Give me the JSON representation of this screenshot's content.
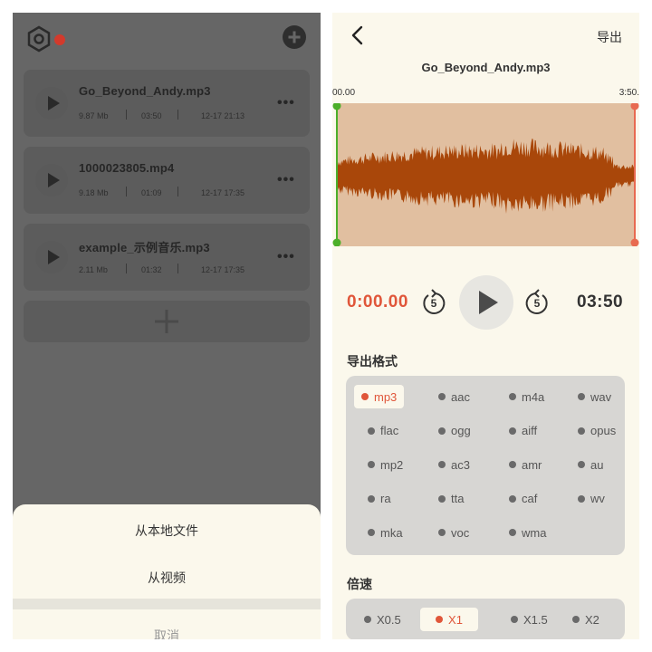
{
  "left": {
    "files": [
      {
        "name": "Go_Beyond_Andy.mp3",
        "size": "9.87 Mb",
        "duration": "03:50",
        "date": "12-17 21:13"
      },
      {
        "name": "1000023805.mp4",
        "size": "9.18 Mb",
        "duration": "01:09",
        "date": "12-17 17:35"
      },
      {
        "name": "example_示例音乐.mp3",
        "size": "2.11 Mb",
        "duration": "01:32",
        "date": "12-17 17:35"
      }
    ],
    "more_label": "•••",
    "sheet": {
      "local_file": "从本地文件",
      "from_video": "从视频",
      "cancel": "取消"
    }
  },
  "right": {
    "export_label": "导出",
    "title": "Go_Beyond_Andy.mp3",
    "time_start": "00.00",
    "time_end": "3:50.",
    "current_time": "0:00.00",
    "total_time": "03:50",
    "skip_seconds": "5",
    "format_label": "导出格式",
    "formats": [
      {
        "label": "mp3",
        "selected": true
      },
      {
        "label": "aac"
      },
      {
        "label": "m4a"
      },
      {
        "label": "wav"
      },
      {
        "label": "flac"
      },
      {
        "label": "ogg"
      },
      {
        "label": "aiff"
      },
      {
        "label": "opus"
      },
      {
        "label": "mp2"
      },
      {
        "label": "ac3"
      },
      {
        "label": "amr"
      },
      {
        "label": "au"
      },
      {
        "label": "ra"
      },
      {
        "label": "tta"
      },
      {
        "label": "caf"
      },
      {
        "label": "wv"
      },
      {
        "label": "mka"
      },
      {
        "label": "voc"
      },
      {
        "label": "wma"
      }
    ],
    "speed_label": "倍速",
    "speeds": [
      {
        "label": "X0.5"
      },
      {
        "label": "X1",
        "selected": true
      },
      {
        "label": "X1.5"
      },
      {
        "label": "X2"
      }
    ]
  },
  "colors": {
    "accent": "#e0563a",
    "waveform": "#a9470a",
    "waveform_bg": "#e1bfa0",
    "start_handle": "#4caf2a",
    "end_handle": "#e86a50",
    "panel_bg": "#fbf8ec"
  }
}
